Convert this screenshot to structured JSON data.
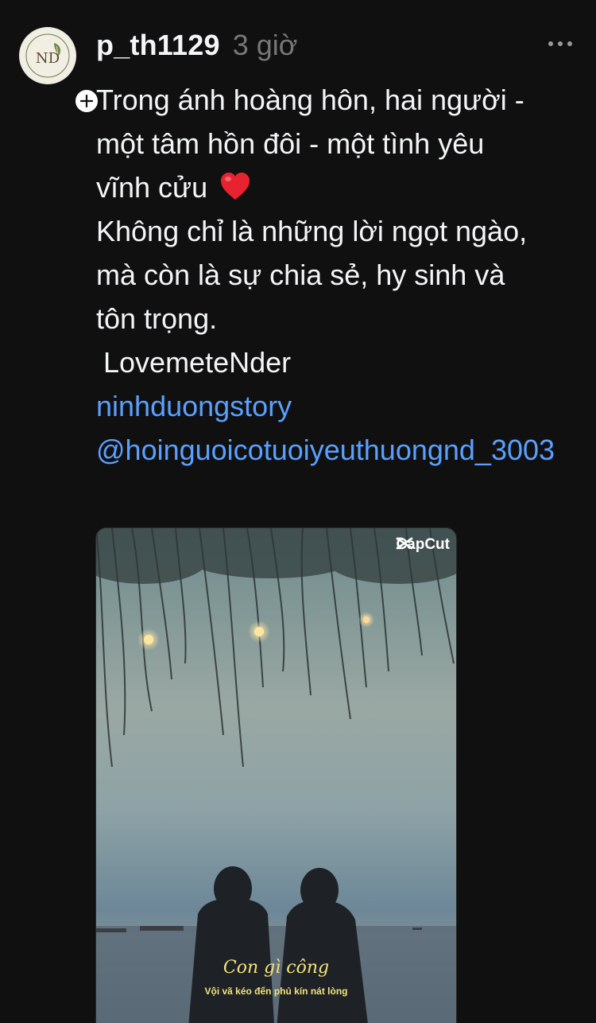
{
  "post": {
    "username": "p_th1129",
    "time": "3 giờ",
    "caption_lines": [
      "Trong ánh hoàng hôn, hai người -",
      "một tâm hồn đôi - một tình yêu",
      "vĩnh cửu",
      "Không chỉ là những lời ngọt ngào,",
      "mà còn là sự chia sẻ, hy sinh và",
      "tôn trọng."
    ],
    "signature": "LovemeteNder",
    "hashtag": "ninhduongstory",
    "mention": "@hoinguoicotuoiyeuthuongnd_3003"
  },
  "avatar": {
    "monogram": "ND"
  },
  "media": {
    "watermark": "CapCut",
    "overlay_title": "Con gì công",
    "overlay_subtitle": "Vội vã kéo đến phủ kín nát lòng"
  },
  "colors": {
    "background": "#101010",
    "link": "#5aa0ff",
    "overlay_text": "#f4e27a"
  },
  "icons": {
    "follow": "plus-icon",
    "more": "more-horizontal-icon",
    "heart": "red-heart-emoji",
    "watermark": "capcut-logo-icon"
  }
}
